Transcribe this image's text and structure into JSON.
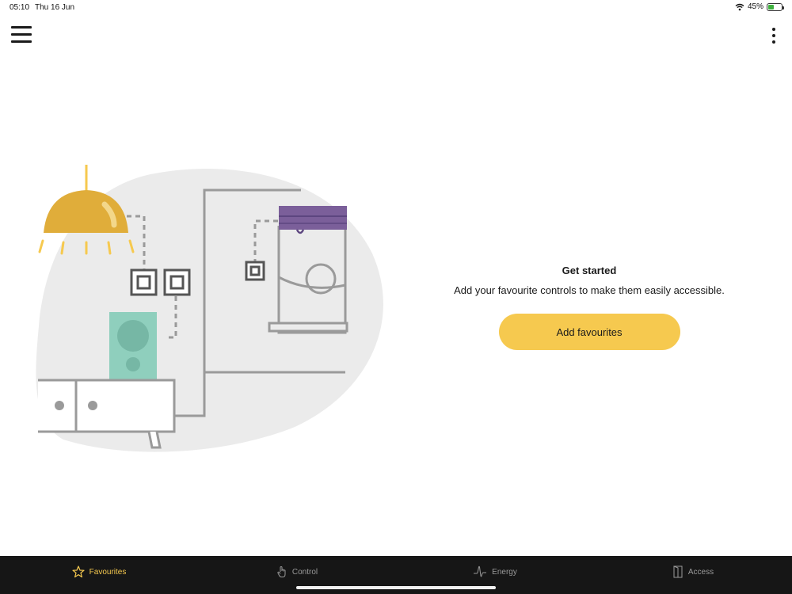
{
  "status_bar": {
    "time": "05:10",
    "date": "Thu 16 Jun",
    "battery_percent": "45%",
    "battery_level": 0.45,
    "icons": [
      "wifi-icon",
      "battery-charging-icon"
    ]
  },
  "header": {
    "menu_icon": "hamburger-menu-icon",
    "more_icon": "more-vertical-icon"
  },
  "empty_state": {
    "title": "Get started",
    "text": "Add your favourite controls to make them easily accessible.",
    "button_label": "Add favourites"
  },
  "tabs": [
    {
      "label": "Favourites",
      "icon": "star-icon",
      "active": true
    },
    {
      "label": "Control",
      "icon": "hand-pointer-icon",
      "active": false
    },
    {
      "label": "Energy",
      "icon": "energy-wave-icon",
      "active": false
    },
    {
      "label": "Access",
      "icon": "door-icon",
      "active": false
    }
  ],
  "colors": {
    "accent": "#f6c94f",
    "tab_bar_background": "#161616",
    "tab_inactive": "#9a9a9a",
    "blind_purple": "#7b5f9a",
    "speaker_teal": "#8fcfbd",
    "lamp_gold": "#e0ad3a"
  }
}
